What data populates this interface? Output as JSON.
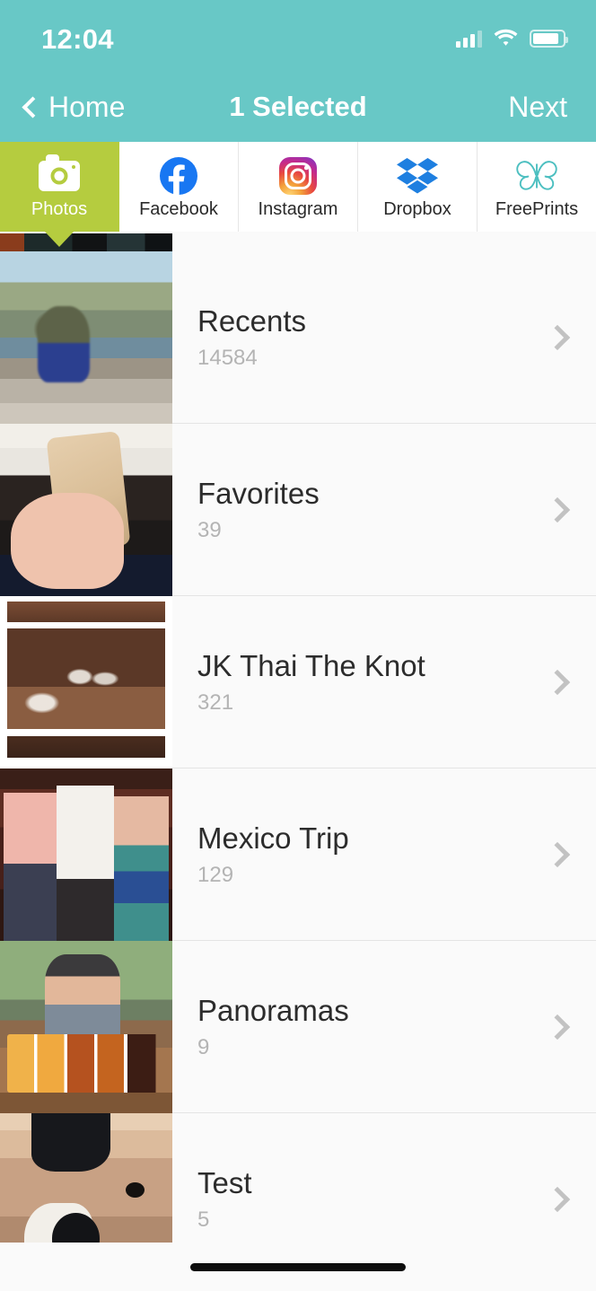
{
  "status_bar": {
    "time": "12:04",
    "signal_icon": "cellular-signal-icon",
    "wifi_icon": "wifi-icon",
    "battery_icon": "battery-icon"
  },
  "nav_bar": {
    "back_label": "Home",
    "back_icon": "chevron-left-icon",
    "title": "1 Selected",
    "next_label": "Next",
    "background_color": "#68c8c6"
  },
  "tabs": {
    "active_index": 0,
    "active_color": "#b5cc3f",
    "items": [
      {
        "label": "Photos",
        "icon": "camera-icon",
        "active": true
      },
      {
        "label": "Facebook",
        "icon": "facebook-icon",
        "active": false
      },
      {
        "label": "Instagram",
        "icon": "instagram-icon",
        "active": false
      },
      {
        "label": "Dropbox",
        "icon": "dropbox-icon",
        "active": false
      },
      {
        "label": "FreePrints",
        "icon": "butterfly-icon",
        "active": false
      }
    ]
  },
  "album_list": {
    "partial_top_row": true,
    "chevron_icon": "chevron-right-icon",
    "albums": [
      {
        "title": "Recents",
        "count": "14584",
        "thumbnail": "woman-and-child-on-rocks-by-lake"
      },
      {
        "title": "Favorites",
        "count": "39",
        "thumbnail": "hand-holding-gold-iphone-over-keyboard"
      },
      {
        "title": "JK Thai The Knot",
        "count": "321",
        "thumbnail": "wedding-group-in-wooden-venue-letterboxed"
      },
      {
        "title": "Mexico Trip",
        "count": "129",
        "thumbnail": "three-friends-posing-at-party"
      },
      {
        "title": "Panoramas",
        "count": "9",
        "thumbnail": "man-with-beer-flight-outdoors"
      },
      {
        "title": "Test",
        "count": "5",
        "thumbnail": "puppy-close-up"
      }
    ]
  },
  "home_indicator": "home-indicator-bar"
}
